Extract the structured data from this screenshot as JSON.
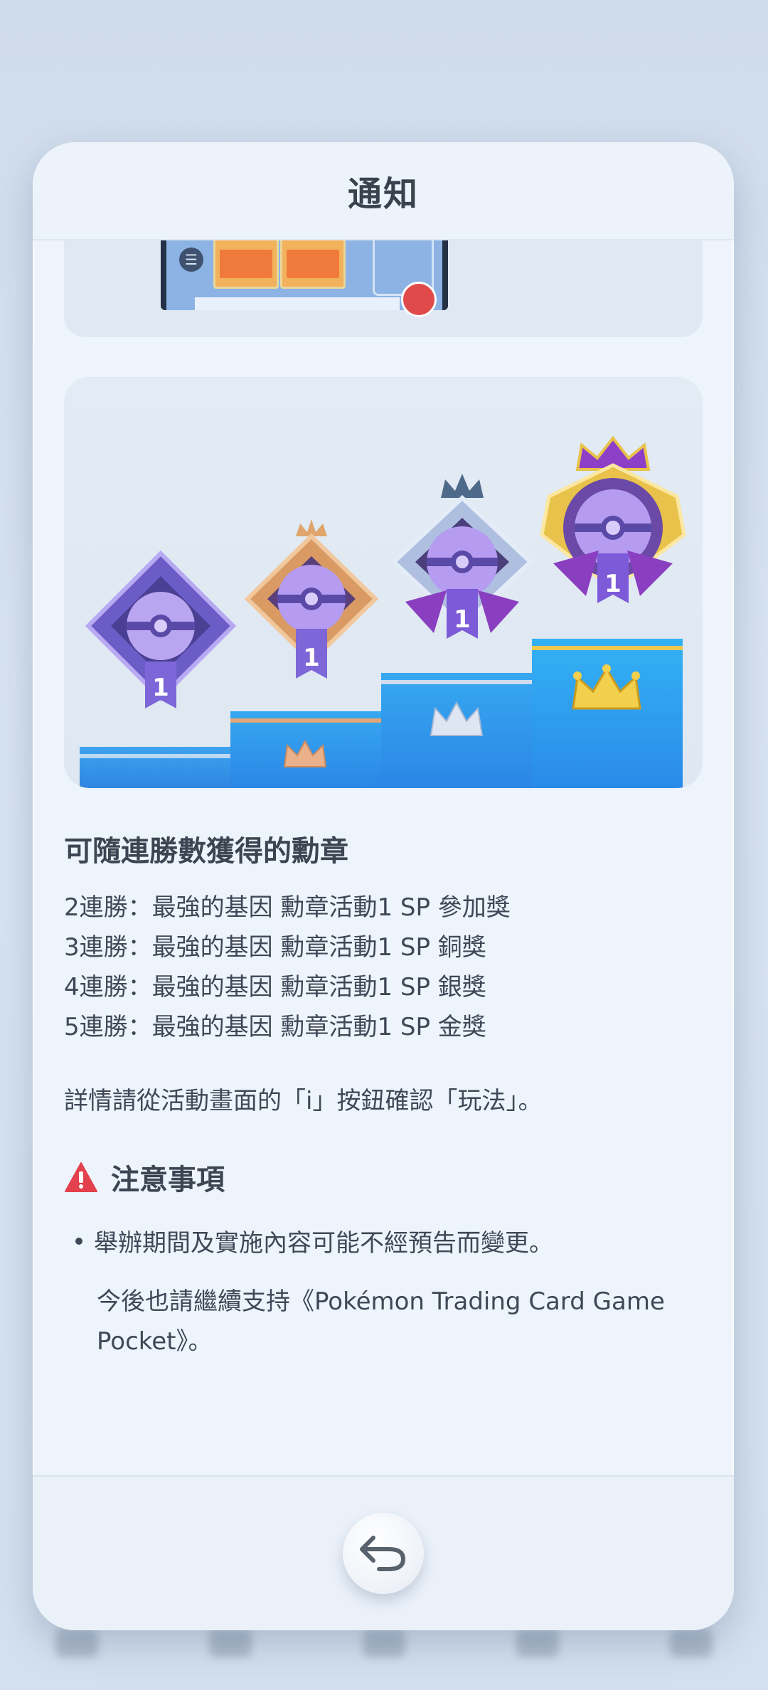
{
  "dialog": {
    "title": "通知"
  },
  "medals": {
    "rank_label": "1",
    "colors": {
      "purple": "#7d6bd4",
      "bronze": "#d99a63",
      "silver": "#b6c4e0",
      "gold": "#e8c24a",
      "podium_blue": "#2f95ec"
    }
  },
  "section": {
    "title": "可隨連勝數獲得的勳章",
    "rewards": [
      "2連勝：最強的基因 勳章活動1 SP 參加獎",
      "3連勝：最強的基因 勳章活動1 SP 銅獎",
      "4連勝：最強的基因 勳章活動1 SP 銀獎",
      "5連勝：最強的基因 勳章活動1 SP 金獎"
    ],
    "details": "詳情請從活動畫面的「i」按鈕確認「玩法」。"
  },
  "notice": {
    "title": "注意事項",
    "icon": "warning-icon",
    "bullet": "舉辦期間及實施內容可能不經預告而變更。",
    "closing": "今後也請繼續支持《Pokémon Trading Card Game Pocket》。"
  },
  "footer": {
    "back_icon": "return-arrow-icon"
  }
}
